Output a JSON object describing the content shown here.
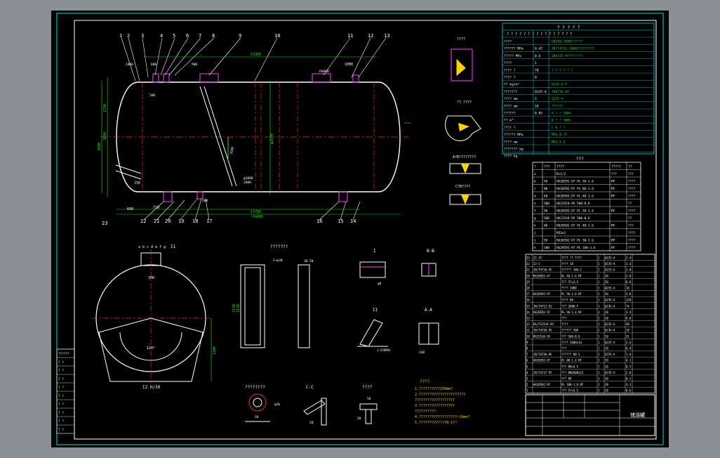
{
  "drawing": {
    "colors": {
      "background": "#000000",
      "frame": "#00e5e5",
      "outline": "#ffffff",
      "center_line": "#ff2a2a",
      "dimension": "#2be32b",
      "leader": "#ffd400",
      "accent": "#ff40ff",
      "viewer_bg": "#8b8f96"
    },
    "title_block_name": "储油罐",
    "main_view": {
      "callouts": [
        "1",
        "2",
        "3",
        "4",
        "5",
        "6",
        "7",
        "8",
        "9",
        "10",
        "11",
        "12",
        "13"
      ],
      "bottom_callouts": [
        "22",
        "21",
        "20",
        "19",
        "18",
        "17",
        "16",
        "15",
        "14"
      ],
      "corner_callout": "23",
      "dims": {
        "overall_length": "17780",
        "shell_length": "~14806",
        "top_span": "13300",
        "diameter": "φ2600",
        "left_height": "1780",
        "height_a": "3000",
        "height_b": "3600",
        "nozzle_gap": "1000",
        "offset": "150",
        "saddle_a": "710",
        "saddle_b": "600",
        "ladder_a": "φ1800",
        "ladder_b": "2600",
        "ladder_c": "3500",
        "sub_a": "500",
        "sub_b": "980",
        "sub_c": "600",
        "sub_d": "1800",
        "nozzle_label": "P6000",
        "misc": "300"
      }
    },
    "section_view": {
      "nozzle_letters": "a b c d e f g",
      "label": "I1",
      "width": "300",
      "angle": "120°",
      "bottom_label": "I2  H/30",
      "dims": [
        "1300",
        "1750",
        "1310"
      ]
    },
    "plate_detail": {
      "title": "???????",
      "dims": [
        "2~φ30",
        "2130",
        "3130",
        "30",
        "50"
      ]
    },
    "detail_views": {
      "I": "I",
      "II": "II",
      "B": "B-B",
      "A": "A-A",
      "C": "C-C",
      "dim_small": [
        "φ8",
        "1:250DN1",
        "240"
      ]
    },
    "small_parts": {
      "flange_title": "????????",
      "flange_dims": [
        "φ26",
        "50"
      ],
      "cc_dims": [
        "20",
        "20"
      ],
      "bracket_title": "????",
      "bracket_dims": [
        "50",
        "20",
        "20"
      ]
    },
    "weld_details": {
      "title_a": "????",
      "title_b": "?? ????",
      "title_c": "A?B????????",
      "title_d": "C?D????"
    },
    "notes": {
      "title": "????",
      "lines": [
        "1.??????????150mm?",
        "2.??????????????????????",
        "  ???????????????????",
        "3.?????????????????",
        "  ??????????",
        "4.??????????????????~10mm?",
        "5.?????????????8-1??"
      ]
    },
    "spec_table": {
      "title": "? ? ? ? ?",
      "header": "? ? ? ?   ? ? ? ? ? ? ? ? ? ? ? ?",
      "rows": [
        [
          "????",
          "",
          "GB150-1998??????"
        ],
        [
          "?????? MPa",
          "0.42",
          "JB/T4731-2000?????????"
        ],
        [
          "????? MPa",
          "0.6",
          "JB4735-97???????"
        ],
        [
          "????",
          "1",
          ""
        ],
        [
          "???? ?",
          "70",
          "? ? ? ? ? ?"
        ],
        [
          "???? ?",
          "0",
          ""
        ],
        [
          "?? kg/m³",
          "",
          "Q235-A.F"
        ],
        [
          "???????",
          "Q235-A",
          "JB4730-94"
        ],
        [
          "???? mm",
          "2",
          "Q235-A"
        ],
        [
          "???? mm",
          "10",
          "??????"
        ],
        [
          "??????",
          "0.85",
          "A  ? ? 100%"
        ],
        [
          "?? m³",
          "",
          "B  ? ? 100%"
        ],
        [
          "???? ?",
          "",
          "C  D ? ?"
        ],
        [
          "?????? MPa",
          "",
          "MPa 0.75"
        ],
        [
          "???? mm",
          "",
          "MPa 0.6"
        ],
        [
          "??????? kg",
          "",
          ""
        ],
        [
          "???? kg",
          "",
          ""
        ]
      ]
    },
    "nozzle_table": {
      "title": "???",
      "header": [
        "?",
        "???",
        "????",
        "?????",
        "??"
      ],
      "rows": [
        [
          "a",
          "-",
          "Rc1/2",
          "???",
          "???"
        ],
        [
          "b",
          "50",
          "HG20592-97 PL 50-1.6",
          "RF",
          "????"
        ],
        [
          "c",
          "80",
          "HG20592-97 PL 80-1.6",
          "RF",
          "????"
        ],
        [
          "d",
          "40",
          "HG20592-97 PL 40-1.6",
          "RF",
          "????"
        ],
        [
          "e",
          "500",
          "HG21518-95 500-0.6",
          "",
          "??"
        ],
        [
          "f",
          "50",
          "HG20592-97 PL 50-1.6",
          "RF",
          "????"
        ],
        [
          "g",
          "500",
          "HG21516-95 500-0.6",
          "",
          "??"
        ],
        [
          "h",
          "40",
          "HG20592-97 PL 40-1.6",
          "RF",
          "???"
        ],
        [
          "i",
          "",
          "M33x2",
          "",
          "????"
        ],
        [
          "j",
          "50",
          "HG20592-97 PL 50-1.6",
          "RF",
          "????"
        ],
        [
          "k",
          "100",
          "HG20592-97 PL 100-1.6",
          "RF",
          "????"
        ]
      ]
    },
    "parts_list": {
      "rows": [
        [
          "23",
          "22-25",
          "???? ?? ????",
          "1",
          "Q235-A",
          "3.4"
        ],
        [
          "22",
          "22-2",
          "???? 18",
          "1",
          "Q235-A",
          "2.4"
        ],
        [
          "21",
          "JB/T4736-95",
          "?????? 100-2",
          "1",
          "Q235-A",
          "2.0"
        ],
        [
          "20",
          "HG20592-97",
          "PL 40-1.6 RF",
          "1",
          "20",
          "3.8"
        ],
        [
          "19",
          "",
          "??? 57x3.5",
          "1",
          "20",
          "0.8"
        ],
        [
          "18",
          "",
          "???? 1000",
          "1",
          "Q235-A",
          "10"
        ],
        [
          "17",
          "HG20592-97",
          "PL 50-1.6 RF",
          "1",
          "20",
          "3.6"
        ],
        [
          "16",
          "",
          "???? 00",
          "2",
          "Q235-A",
          "120"
        ],
        [
          "15",
          "JB/T4712-92",
          "??? 2600-F",
          "1",
          "Q235-A",
          "74"
        ],
        [
          "14",
          "HG20592-97",
          "PL 50-1.6 RF",
          "1",
          "20",
          "3.4"
        ],
        [
          "13",
          "",
          "???",
          "2",
          "20",
          "0.6"
        ],
        [
          "12",
          "HG/T21514-95",
          "????",
          "1",
          "Q235-A",
          "48"
        ],
        [
          "11",
          "JB/T4736-95",
          "?????? 500",
          "2",
          "Q235-A",
          "10"
        ],
        [
          "10",
          "HG21516-95",
          "??? 500-0.6",
          "1",
          "20",
          "31"
        ],
        [
          "9",
          "",
          "???? 2600x14",
          "1",
          "Q235-A",
          "3.6"
        ],
        [
          "8",
          "",
          "???",
          "1",
          "20",
          "0.4"
        ],
        [
          "7",
          "JB/T4736-95",
          "?????? 80-2",
          "1",
          "Q235-A",
          "1.6"
        ],
        [
          "6",
          "HG20592-97",
          "PL 80-1.6 RF",
          "1",
          "20",
          "4.1"
        ],
        [
          "5",
          "",
          "??? 89x4.5",
          "1",
          "20",
          "0.5"
        ],
        [
          "4",
          "JB/T4737-95",
          "??? DN2600x12",
          "2",
          "Q235-A",
          "2.0"
        ],
        [
          "3",
          "",
          "??? 89",
          "1",
          "20",
          "0.2"
        ],
        [
          "2",
          "HG20592-97",
          "PL 100-1.6 RF",
          "1",
          "20",
          "4.3"
        ],
        [
          "1",
          "",
          "??? 57x3.5",
          "1",
          "20",
          "0.6"
        ]
      ]
    },
    "left_strip": [
      "??????",
      "? ?",
      "? ?",
      "? ?",
      "? ?",
      "? ?",
      "? ?",
      "? ?",
      "? ?",
      "? ?"
    ]
  }
}
